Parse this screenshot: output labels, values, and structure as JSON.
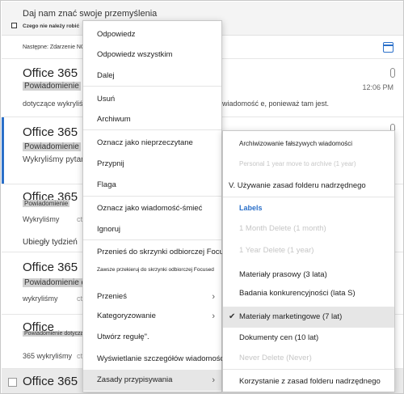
{
  "feedback": {
    "title": "Daj nam znać swoje przemyślenia",
    "subtitle": "Czego nie należy robić"
  },
  "next_event": "Następne: Zdarzenie NO",
  "messages": [
    {
      "sender": "Office 365",
      "sender_cut": "A",
      "subject": "Powiadomienie",
      "preview": "dotyczące wykryliśmy",
      "snippet": "wiadomość e, ponieważ tam jest.",
      "time": "12:06 PM"
    },
    {
      "sender": "Office 365",
      "sender_cut": "A",
      "subject": "Powiadomienie",
      "preview": "Wykryliśmy pytanie"
    },
    {
      "sender": "Office 365",
      "sender_cut": "A",
      "subject": "Powiadomienie",
      "preview": "Wykryliśmy",
      "preview_cut": "ct"
    },
    {
      "sender": "Office 365",
      "sender_cut": "A",
      "subject": "Powiadomienie dotyczące",
      "preview": "wykryliśmy",
      "preview_cut": "ct"
    },
    {
      "sender": "Office",
      "subject": "Powiadomienie dotyczące",
      "preview": "365 wykryliśmy",
      "preview_cut": "ct"
    },
    {
      "sender": "Office 365",
      "sender_cut": "A"
    }
  ],
  "week_header": "Ubiegły tydzień",
  "context_menu": {
    "items": [
      {
        "label": "Odpowiedz"
      },
      {
        "label": "Odpowiedz wszystkim"
      },
      {
        "label": "Dalej"
      },
      {
        "label": "Usuń"
      },
      {
        "label": "Archiwum"
      },
      {
        "label": "Oznacz jako nieprzeczytane"
      },
      {
        "label": "Przypnij"
      },
      {
        "label": "Flaga"
      },
      {
        "label": "Oznacz jako wiadomość-śmieć"
      },
      {
        "label": "Ignoruj"
      },
      {
        "label": "Przenieś do skrzynki odbiorczej Focused"
      },
      {
        "label": "Zawsze przekieruj do skrzynki odbiorczej Focused"
      },
      {
        "label": "Przenieś"
      },
      {
        "label": "Kategoryzowanie"
      },
      {
        "label": "Utwórz regułę\"."
      },
      {
        "label": "Wyświetlanie szczegółów wiadomości"
      },
      {
        "label": "Zasady przypisywania"
      }
    ],
    "chevron": "›"
  },
  "submenu": {
    "items": [
      {
        "label": "Archiwizowanie fałszywych wiadomości"
      },
      {
        "label": "Personal 1 year move to archive (1 year)"
      },
      {
        "label": "V. Używanie zasad folderu nadrzędnego"
      },
      {
        "label": "Labels"
      },
      {
        "label": "1 Month Delete (1 month)"
      },
      {
        "label": "1 Year Delete (1 year)"
      },
      {
        "label": "Materiały prasowy (3 lata)"
      },
      {
        "label": "Badania konkurencyjności (lata S)"
      },
      {
        "label": "Materiały marketingowe (7 lat)"
      },
      {
        "label": "Dokumenty cen (10 lat)"
      },
      {
        "label": "Never Delete (Never)"
      },
      {
        "label": "Korzystanie z zasad folderu nadrzędnego"
      }
    ],
    "checkmark": "✔"
  },
  "colors": {
    "accent": "#2b70c9",
    "highlight": "#e6e6e6",
    "disabled_text": "#c6c6c6"
  }
}
